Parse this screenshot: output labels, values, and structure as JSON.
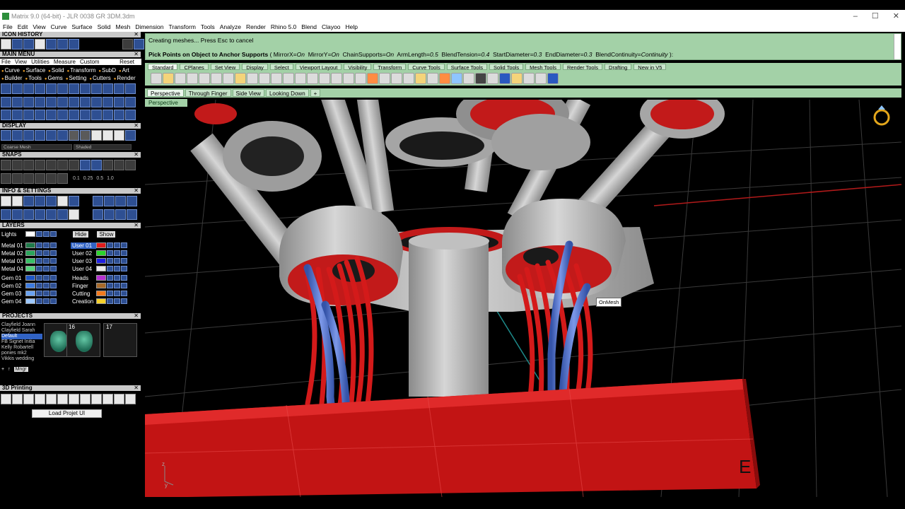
{
  "window": {
    "title": "Matrix 9.0 (64-bit) - JLR 0038 GR 3DM.3dm",
    "controls": [
      "–",
      "☐",
      "✕"
    ]
  },
  "menubar": [
    "File",
    "Edit",
    "View",
    "Curve",
    "Surface",
    "Solid",
    "Mesh",
    "Dimension",
    "Transform",
    "Tools",
    "Analyze",
    "Render",
    "Rhino 5.0",
    "Blend",
    "Clayoo",
    "Help"
  ],
  "left": {
    "icon_history": "ICON HISTORY",
    "main_menu": "MAIN MENU",
    "mm_menu": [
      "File",
      "View",
      "Utilities",
      "Measure",
      "Custom"
    ],
    "mm_reset": "Reset",
    "mm_row1": [
      "Curve",
      "Surface",
      "Solid",
      "Transform",
      "SubD",
      "Art"
    ],
    "mm_row2": [
      "Builder",
      "Tools",
      "Gems",
      "Setting",
      "Cutters",
      "Render"
    ],
    "display": "DISPLAY",
    "display_dd1": "Coarse Mesh",
    "display_dd2": "Shaded",
    "snaps": "SNAPS",
    "snap_values": [
      "0.1",
      "0.25",
      "0.5",
      "1.0"
    ],
    "info": "INFO & SETTINGS",
    "layers": "LAYERS",
    "lights": "Lights",
    "hide": "Hide",
    "show": "Show",
    "layers_left": [
      {
        "name": "Metal 01",
        "color": "#1f7a4a"
      },
      {
        "name": "Metal 02",
        "color": "#2aa55b"
      },
      {
        "name": "Metal 03",
        "color": "#38c066"
      },
      {
        "name": "Metal 04",
        "color": "#56d37d"
      },
      {
        "name": "Gem 01",
        "color": "#1d55c5"
      },
      {
        "name": "Gem 02",
        "color": "#3d7be0"
      },
      {
        "name": "Gem 03",
        "color": "#6aa3f2"
      },
      {
        "name": "Gem 04",
        "color": "#9ec9ff"
      }
    ],
    "layers_right": [
      {
        "name": "User 01",
        "color": "#e01d1d"
      },
      {
        "name": "User 02",
        "color": "#2ad42a"
      },
      {
        "name": "User 03",
        "color": "#2020e0"
      },
      {
        "name": "User 04",
        "color": "#eaeaea"
      },
      {
        "name": "Heads",
        "color": "#b52fd0"
      },
      {
        "name": "Finger",
        "color": "#a76a2a"
      },
      {
        "name": "Cutting",
        "color": "#f27a1d"
      },
      {
        "name": "Creation",
        "color": "#f5d02b"
      }
    ],
    "projects": "PROJECTS",
    "project_list": [
      "Clayfield Joann",
      "Clayfield Sarah",
      "Default",
      "FB Signet Initia",
      "Kelly Robartell",
      "ponies mk2",
      "Vikkis wedding"
    ],
    "project_selected": "Default",
    "thumb_nums": [
      "16",
      "17"
    ],
    "mngr": "Mngr",
    "printing": "3D Printing",
    "load_projet": "Load Projet UI"
  },
  "command": {
    "line1": "Creating meshes... Press Esc to cancel",
    "prompt": "Pick Points on Object to Anchor Supports",
    "opts": [
      {
        "k": "MirrorX",
        "v": "On"
      },
      {
        "k": "MirrorY",
        "v": "On"
      },
      {
        "k": "ChainSupports",
        "v": "On"
      },
      {
        "k": "ArmLength",
        "v": "0.5"
      },
      {
        "k": "BlendTension",
        "v": "0.4"
      },
      {
        "k": "StartDiameter",
        "v": "0.3"
      },
      {
        "k": "EndDiameter",
        "v": "0.3"
      },
      {
        "k": "BlendContinuity",
        "v": "Continuity"
      }
    ]
  },
  "toolbar_tabs": [
    "Standard",
    "CPlanes",
    "Set View",
    "Display",
    "Select",
    "Viewport Layout",
    "Visibility",
    "Transform",
    "Curve Tools",
    "Surface Tools",
    "Solid Tools",
    "Mesh Tools",
    "Render Tools",
    "Drafting",
    "New in V5"
  ],
  "viewport_tabs": [
    "Perspective",
    "Through Finger",
    "Side View",
    "Looking Down"
  ],
  "viewport_label": "Perspective",
  "viewport": {
    "tooltip": "OnMesh",
    "axis_z": "z",
    "axis_y": "y",
    "corner_letter": "E",
    "colors": {
      "metal": "#a8a8a8",
      "support_red": "#d41a1a",
      "support_blue": "#4a6fd1",
      "base": "#c01414"
    }
  }
}
